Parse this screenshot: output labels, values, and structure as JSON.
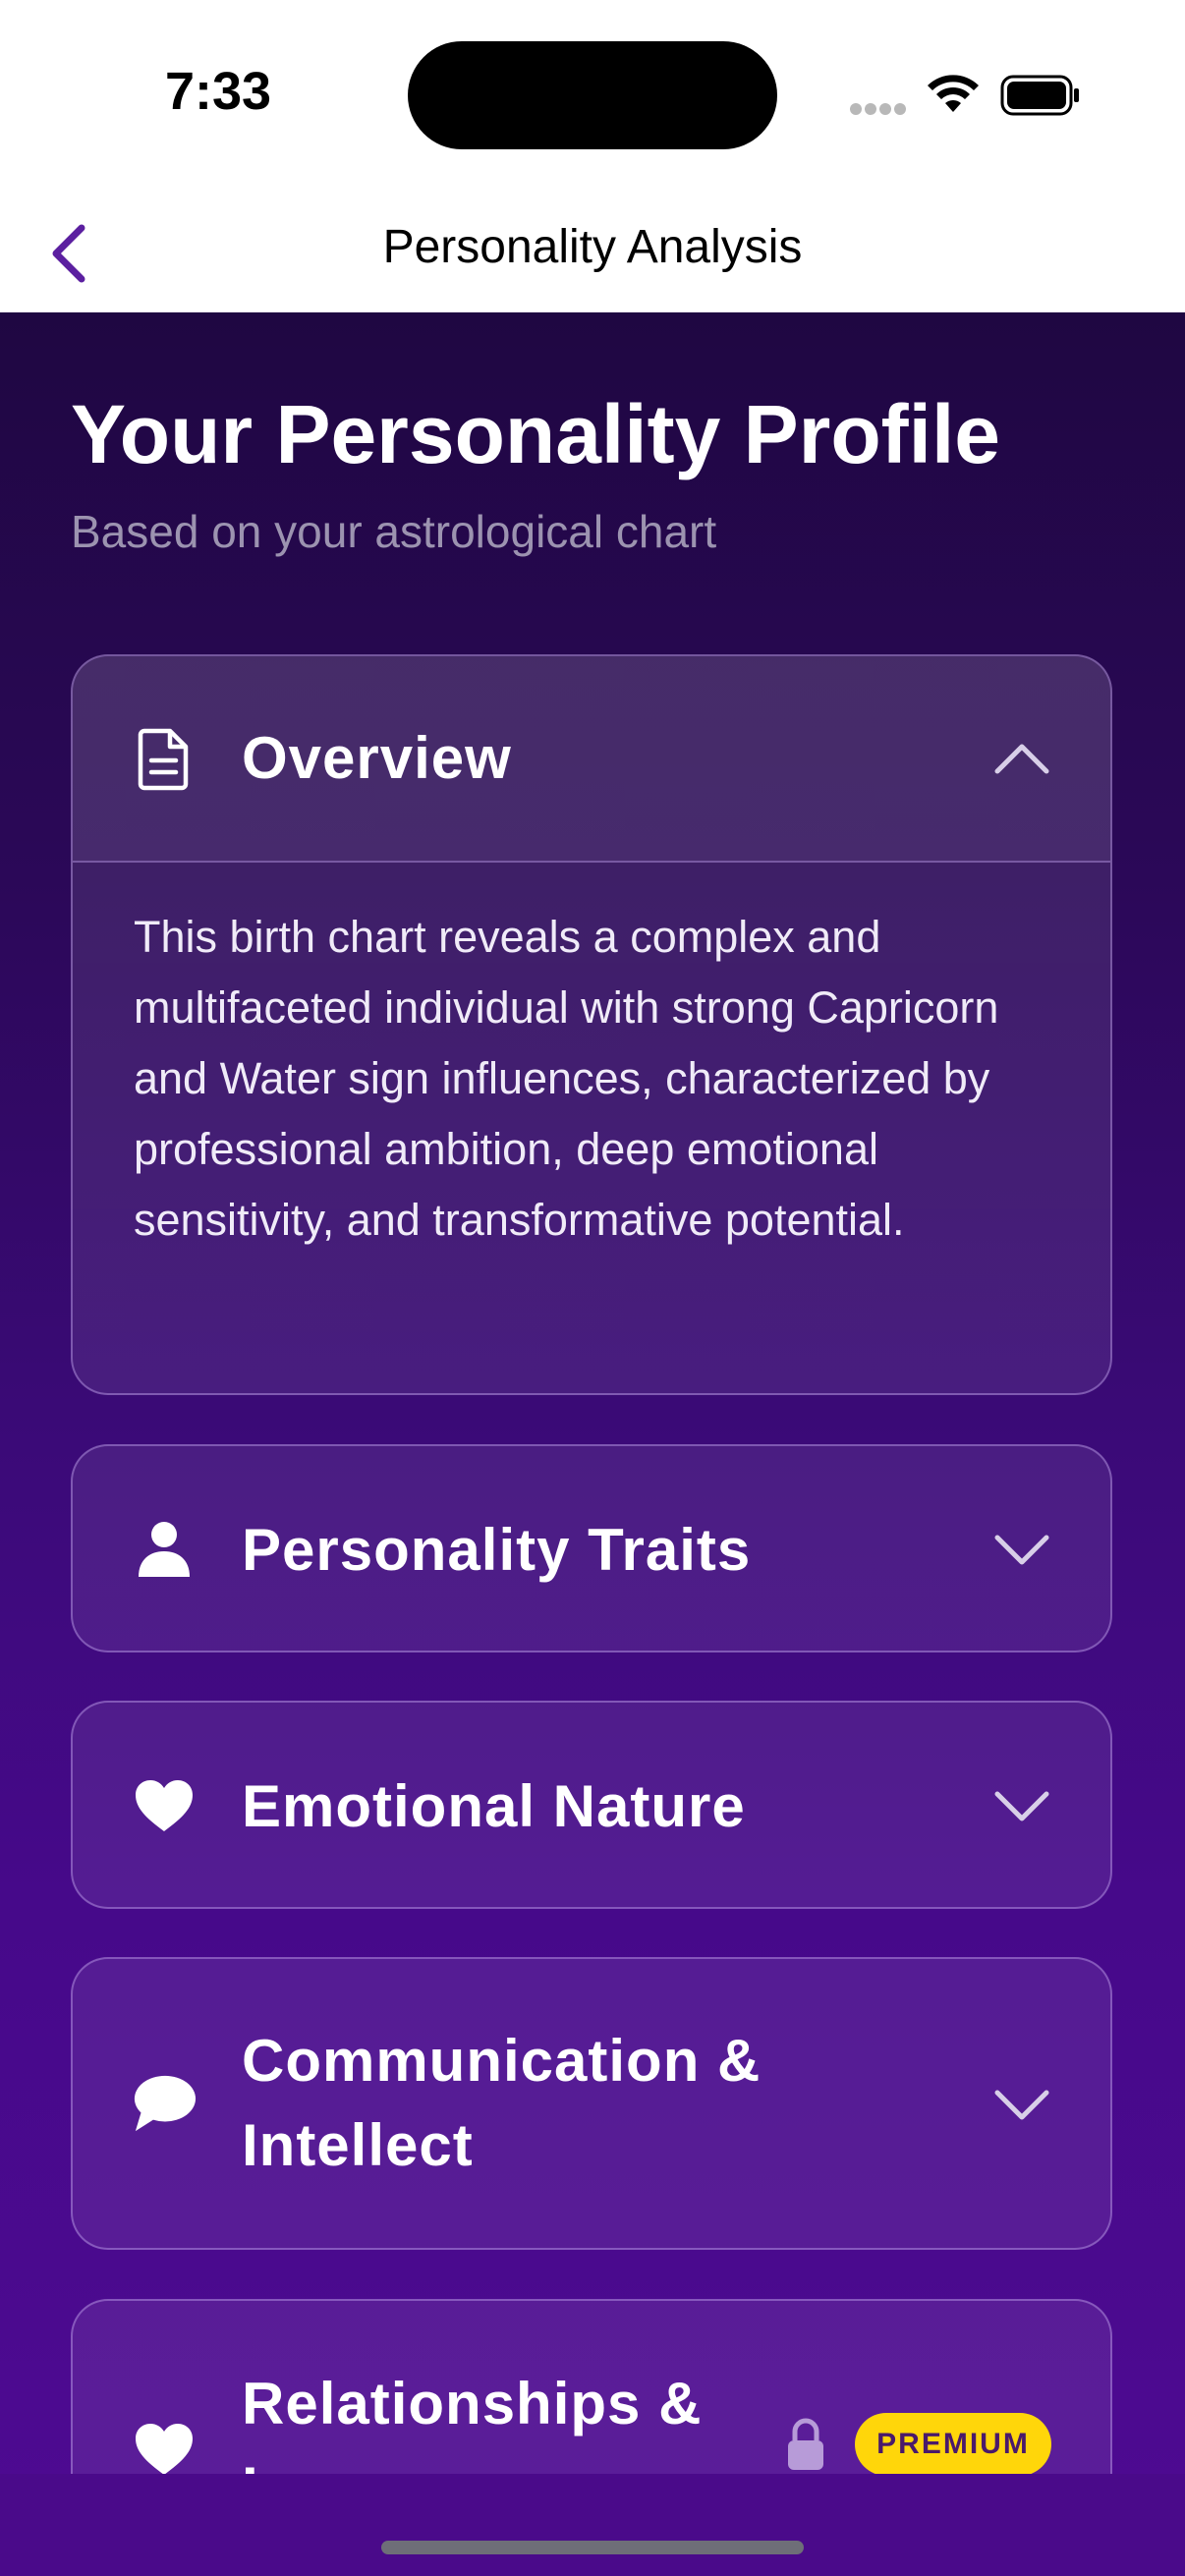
{
  "status_bar": {
    "time": "7:33"
  },
  "nav": {
    "title": "Personality Analysis",
    "back_icon": "chevron-left-icon"
  },
  "header": {
    "title": "Your Personality Profile",
    "subtitle": "Based on your astrological chart"
  },
  "sections": [
    {
      "label": "Overview",
      "icon": "document-icon",
      "expanded": true,
      "body": "This birth chart reveals a complex and multifaceted individual with strong Capricorn and Water sign influences, characterized by professional ambition, deep emotional sensitivity, and transformative potential."
    },
    {
      "label": "Personality Traits",
      "icon": "person-icon",
      "expanded": false
    },
    {
      "label": "Emotional Nature",
      "icon": "heart-icon",
      "expanded": false
    },
    {
      "label": "Communication & Intellect",
      "icon": "speech-bubble-icon",
      "expanded": false
    },
    {
      "label": "Relationships & L",
      "icon": "heart-icon",
      "expanded": false,
      "locked": true,
      "badge": "PREMIUM"
    }
  ],
  "colors": {
    "accent": "#5b1fa0",
    "badge": "#ffd60a",
    "background_top": "#1f0742",
    "background_bottom": "#4e0a92"
  }
}
